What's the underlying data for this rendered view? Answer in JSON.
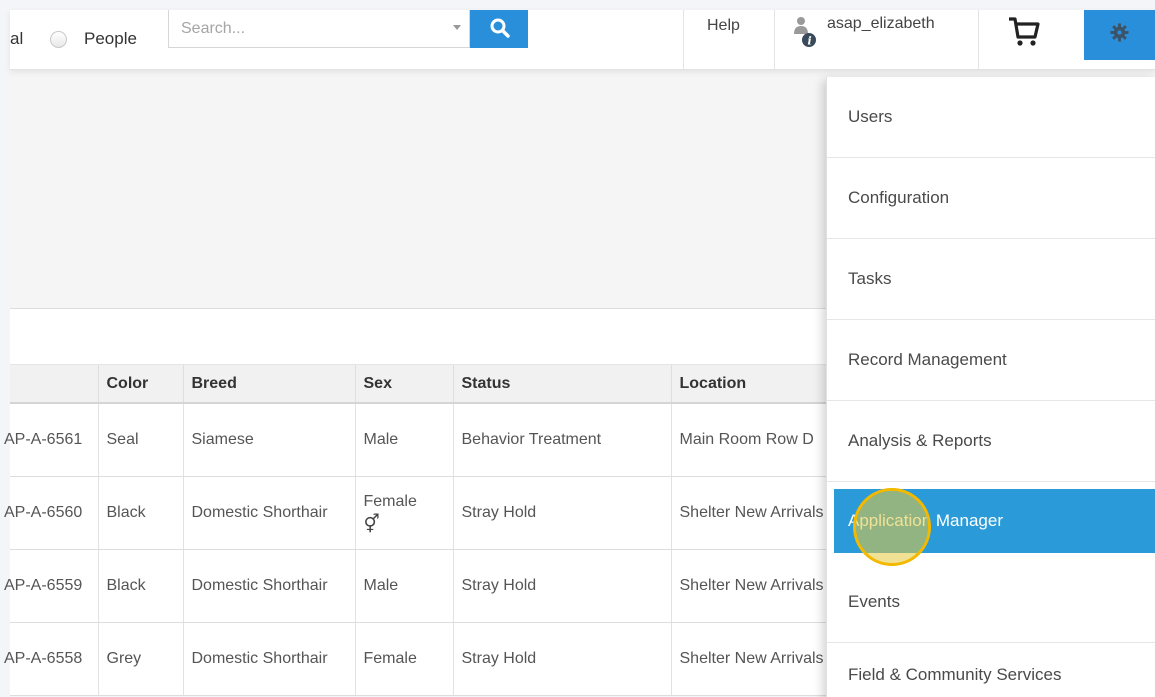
{
  "header": {
    "radio_fragment": "al",
    "radio_people": "People",
    "search_placeholder": "Search...",
    "help": "Help",
    "username": "asap_elizabeth"
  },
  "table": {
    "columns": [
      "",
      "Color",
      "Breed",
      "Sex",
      "Status",
      "Location"
    ],
    "rows": [
      {
        "id": "AP-A-6561",
        "color": "Seal",
        "breed": "Siamese",
        "sex": "Male",
        "status": "Behavior Treatment",
        "location": "Main Room Row D"
      },
      {
        "id": "AP-A-6560",
        "color": "Black",
        "breed": "Domestic Shorthair",
        "sex": "Female",
        "status": "Stray Hold",
        "location": "Shelter New Arrivals"
      },
      {
        "id": "AP-A-6559",
        "color": "Black",
        "breed": "Domestic Shorthair",
        "sex": "Male",
        "status": "Stray Hold",
        "location": "Shelter New Arrivals"
      },
      {
        "id": "AP-A-6558",
        "color": "Grey",
        "breed": "Domestic Shorthair",
        "sex": "Female",
        "status": "Stray Hold",
        "location": "Shelter New Arrivals"
      }
    ]
  },
  "menu": {
    "items": [
      {
        "label": "Users",
        "active": false
      },
      {
        "label": "Configuration",
        "active": false
      },
      {
        "label": "Tasks",
        "active": false
      },
      {
        "label": "Record Management",
        "active": false
      },
      {
        "label": "Analysis & Reports",
        "active": false
      },
      {
        "label": "Application Manager",
        "active": true
      },
      {
        "label": "Events",
        "active": false
      },
      {
        "label": "Field & Community Services",
        "active": false
      }
    ]
  },
  "colors": {
    "accent": "#2a8fdb",
    "menu_active": "#2a9bd8",
    "click_marker": "#f2b900"
  },
  "icons": {
    "search": "search-icon",
    "user": "user-info-icon",
    "cart": "cart-icon",
    "settings": "gear-icon",
    "female": "female-symbol-icon"
  }
}
